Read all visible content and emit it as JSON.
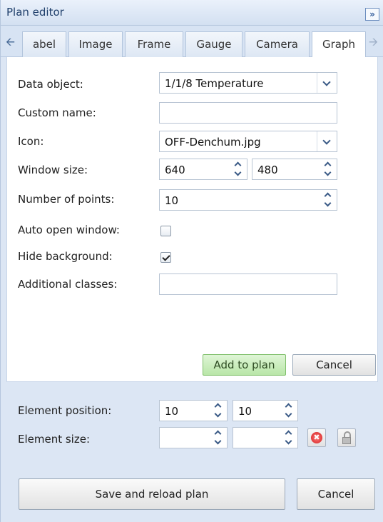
{
  "window": {
    "title": "Plan editor",
    "collapse_icon": "double-chevron-right-icon",
    "collapse_glyph": "»"
  },
  "tabs": {
    "scroll_left_icon": "arrow-left-icon",
    "scroll_right_icon": "arrow-right-icon",
    "items": [
      "abel",
      "Image",
      "Frame",
      "Gauge",
      "Camera",
      "Graph"
    ],
    "active": "Graph"
  },
  "form": {
    "data_object": {
      "label": "Data object:",
      "value": "1/1/8 Temperature"
    },
    "custom_name": {
      "label": "Custom name:",
      "value": ""
    },
    "icon": {
      "label": "Icon:",
      "value": "OFF-Denchum.jpg"
    },
    "window_size": {
      "label": "Window size:",
      "width": "640",
      "height": "480"
    },
    "number_of_points": {
      "label": "Number of points:",
      "value": "10"
    },
    "auto_open_window": {
      "label": "Auto open window:",
      "checked": false
    },
    "hide_background": {
      "label": "Hide background:",
      "checked": true
    },
    "additional_classes": {
      "label": "Additional classes:",
      "value": ""
    },
    "add_to_plan_label": "Add to plan",
    "cancel_label": "Cancel"
  },
  "element": {
    "position_label": "Element position:",
    "position_x": "10",
    "position_y": "10",
    "size_label": "Element size:",
    "size_w": "",
    "size_h": "",
    "delete_icon": "delete-icon",
    "lock_icon": "lock-icon"
  },
  "footer": {
    "save_label": "Save and reload plan",
    "cancel_label": "Cancel"
  },
  "colors": {
    "panel_bg": "#dce6f4",
    "tab_active_bg": "#ffffff",
    "add_button_bg": "#c7ebb9",
    "delete_icon": "#d21f1f"
  }
}
